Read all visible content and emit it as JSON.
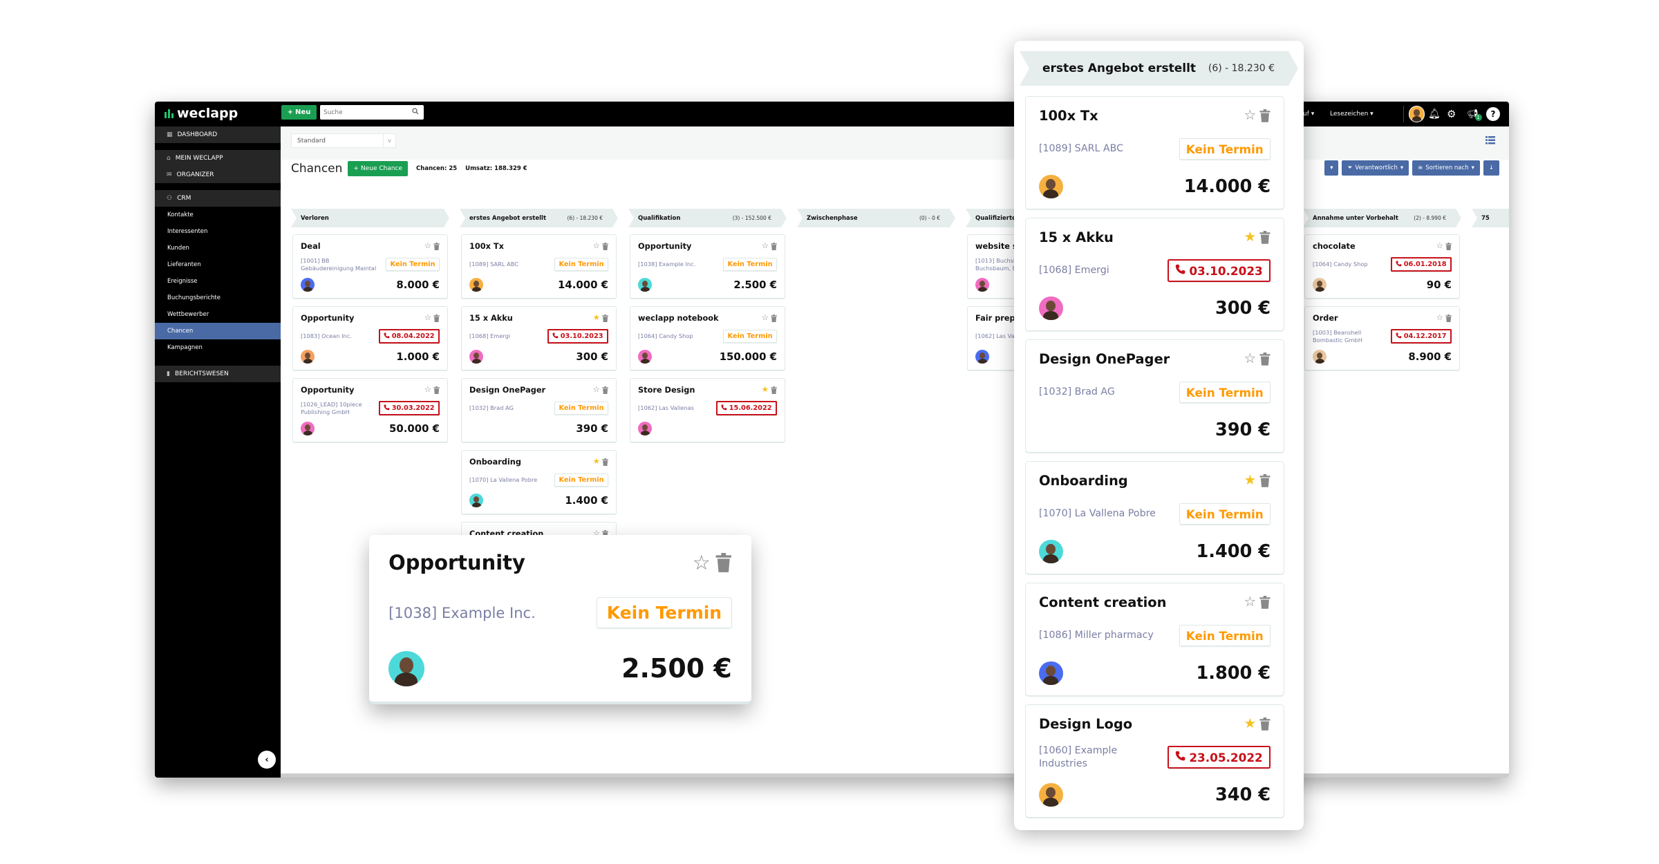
{
  "app": {
    "logo": "weclapp",
    "new_label": "Neu",
    "search_placeholder": "Suche"
  },
  "topbar": {
    "menu_partial": "uf",
    "bookmarks": "Lesezeichen",
    "notification_badge": "1",
    "help": "?"
  },
  "sidebar": {
    "items": [
      {
        "label": "DASHBOARD",
        "type": "group",
        "icon": "dashboard-icon"
      },
      {
        "label": "MEIN WECLAPP",
        "type": "group",
        "icon": "home-icon"
      },
      {
        "label": "ORGANIZER",
        "type": "group",
        "icon": "mail-icon"
      },
      {
        "label": "CRM",
        "type": "group",
        "icon": "users-icon"
      },
      {
        "label": "Kontakte",
        "type": "item"
      },
      {
        "label": "Interessenten",
        "type": "item"
      },
      {
        "label": "Kunden",
        "type": "item"
      },
      {
        "label": "Lieferanten",
        "type": "item"
      },
      {
        "label": "Ereignisse",
        "type": "item"
      },
      {
        "label": "Buchungsberichte",
        "type": "item"
      },
      {
        "label": "Wettbewerber",
        "type": "item"
      },
      {
        "label": "Chancen",
        "type": "item",
        "active": true
      },
      {
        "label": "Kampagnen",
        "type": "item"
      },
      {
        "label": "BERICHTSWESEN",
        "type": "group",
        "icon": "bar-chart-icon"
      }
    ]
  },
  "toolbar": {
    "view_select": "Standard",
    "title": "Chancen",
    "new_chance": "Neue Chance",
    "count": "Chancen: 25",
    "revenue": "Umsatz: 188.329 €",
    "filter_buttons": [
      "Verantwortlich",
      "Sortieren nach"
    ]
  },
  "colors": {
    "accent_green": "#1a9f52",
    "accent_blue": "#4a6aa5",
    "no_appointment": "#ff9900",
    "overdue": "#c8101a",
    "company_ref": "#7a7ea3"
  },
  "board": {
    "columns": [
      {
        "title": "Verloren",
        "summary": "",
        "cards": [
          {
            "title": "Deal",
            "ref": "[1001] BB Gebäudereinigung Maintal",
            "termin": "Kein Termin",
            "due": false,
            "value": "8.000 €",
            "starred": false,
            "avatar": "#4a6cf0"
          },
          {
            "title": "Opportunity",
            "ref": "[1083] Ocean Inc.",
            "termin": "08.04.2022",
            "due": true,
            "value": "1.000 €",
            "starred": false,
            "avatar": "#f5a060"
          },
          {
            "title": "Opportunity",
            "ref": "[1026_LEAD] 10piece Publishing GmbH",
            "termin": "30.03.2022",
            "due": true,
            "value": "50.000 €",
            "starred": false,
            "avatar": "#f06cc0"
          }
        ]
      },
      {
        "title": "erstes Angebot erstellt",
        "summary": "(6) - 18.230 €",
        "cards": [
          {
            "title": "100x Tx",
            "ref": "[1089] SARL ABC",
            "termin": "Kein Termin",
            "due": false,
            "value": "14.000 €",
            "starred": false,
            "avatar": "#f5b040"
          },
          {
            "title": "15 x Akku",
            "ref": "[1068] Emergi",
            "termin": "03.10.2023",
            "due": true,
            "value": "300 €",
            "starred": true,
            "avatar": "#f06cc0"
          },
          {
            "title": "Design OnePager",
            "ref": "[1032] Brad AG",
            "termin": "Kein Termin",
            "due": false,
            "value": "390 €",
            "starred": false,
            "avatar": ""
          },
          {
            "title": "Onboarding",
            "ref": "[1070] La Vallena Pobre",
            "termin": "Kein Termin",
            "due": false,
            "value": "1.400 €",
            "starred": true,
            "avatar": "#4dd9d9"
          },
          {
            "title": "Content creation",
            "ref": "[1086] Miller pharmacy",
            "termin": "Kein Termin",
            "due": false,
            "value": "",
            "starred": false,
            "avatar": ""
          }
        ]
      },
      {
        "title": "Qualifikation",
        "summary": "(3) - 152.500 €",
        "cards": [
          {
            "title": "Opportunity",
            "ref": "[1038] Example Inc.",
            "termin": "Kein Termin",
            "due": false,
            "value": "2.500 €",
            "starred": false,
            "avatar": "#4dd9d9"
          },
          {
            "title": "weclapp notebook",
            "ref": "[1064] Candy Shop",
            "termin": "Kein Termin",
            "due": false,
            "value": "150.000 €",
            "starred": false,
            "avatar": "#f06cc0"
          },
          {
            "title": "Store Design",
            "ref": "[1062] Las Vallenas",
            "termin": "15.06.2022",
            "due": true,
            "value": "",
            "starred": true,
            "avatar": "#f06cc0"
          }
        ]
      },
      {
        "title": "Zwischenphase",
        "summary": "(0) - 0 €",
        "cards": []
      },
      {
        "title": "Qualifizierte",
        "summary": "",
        "cards": [
          {
            "title": "website su",
            "ref": "[1013] Buchsba Buchsbaum, Be",
            "termin": "",
            "due": false,
            "value": "",
            "starred": false,
            "avatar": "#f06cc0"
          },
          {
            "title": "Fair preper",
            "ref": "[1062] Las Valle",
            "termin": "",
            "due": false,
            "value": "",
            "starred": false,
            "avatar": "#4a6cf0"
          }
        ]
      },
      {
        "title": "",
        "summary": "",
        "cards": []
      },
      {
        "title": "Annahme unter Vorbehalt",
        "summary": "(2) - 8.990 €",
        "cards": [
          {
            "title": "chocolate",
            "ref": "[1064] Candy Shop",
            "termin": "06.01.2018",
            "due": true,
            "value": "90 €",
            "starred": false,
            "avatar": "#e8c8a0"
          },
          {
            "title": "Order",
            "ref": "[1003] Beanshell Bombastic GmbH",
            "termin": "04.12.2017",
            "due": true,
            "value": "8.900 €",
            "starred": false,
            "avatar": "#e8c8a0"
          }
        ]
      },
      {
        "title": "75",
        "summary": "",
        "cards": []
      }
    ]
  },
  "floating_card": {
    "title": "Opportunity",
    "ref": "[1038] Example Inc.",
    "termin": "Kein Termin",
    "due": false,
    "value": "2.500 €",
    "starred": false,
    "avatar": "#4dd9d9"
  },
  "panel": {
    "title": "erstes Angebot erstellt",
    "summary": "(6) - 18.230 €",
    "cards": [
      {
        "title": "100x Tx",
        "ref": "[1089] SARL ABC",
        "termin": "Kein Termin",
        "due": false,
        "value": "14.000 €",
        "starred": false,
        "avatar": "#f5b040"
      },
      {
        "title": "15 x Akku",
        "ref": "[1068] Emergi",
        "termin": "03.10.2023",
        "due": true,
        "value": "300 €",
        "starred": true,
        "avatar": "#f06cc0"
      },
      {
        "title": "Design OnePager",
        "ref": "[1032] Brad AG",
        "termin": "Kein Termin",
        "due": false,
        "value": "390 €",
        "starred": false,
        "avatar": ""
      },
      {
        "title": "Onboarding",
        "ref": "[1070] La Vallena Pobre",
        "termin": "Kein Termin",
        "due": false,
        "value": "1.400 €",
        "starred": true,
        "avatar": "#4dd9d9"
      },
      {
        "title": "Content creation",
        "ref": "[1086] Miller pharmacy",
        "termin": "Kein Termin",
        "due": false,
        "value": "1.800 €",
        "starred": false,
        "avatar": "#4a6cf0"
      },
      {
        "title": "Design Logo",
        "ref": "[1060] Example Industries",
        "termin": "23.05.2022",
        "due": true,
        "value": "340 €",
        "starred": true,
        "avatar": "#f5b040"
      }
    ]
  }
}
